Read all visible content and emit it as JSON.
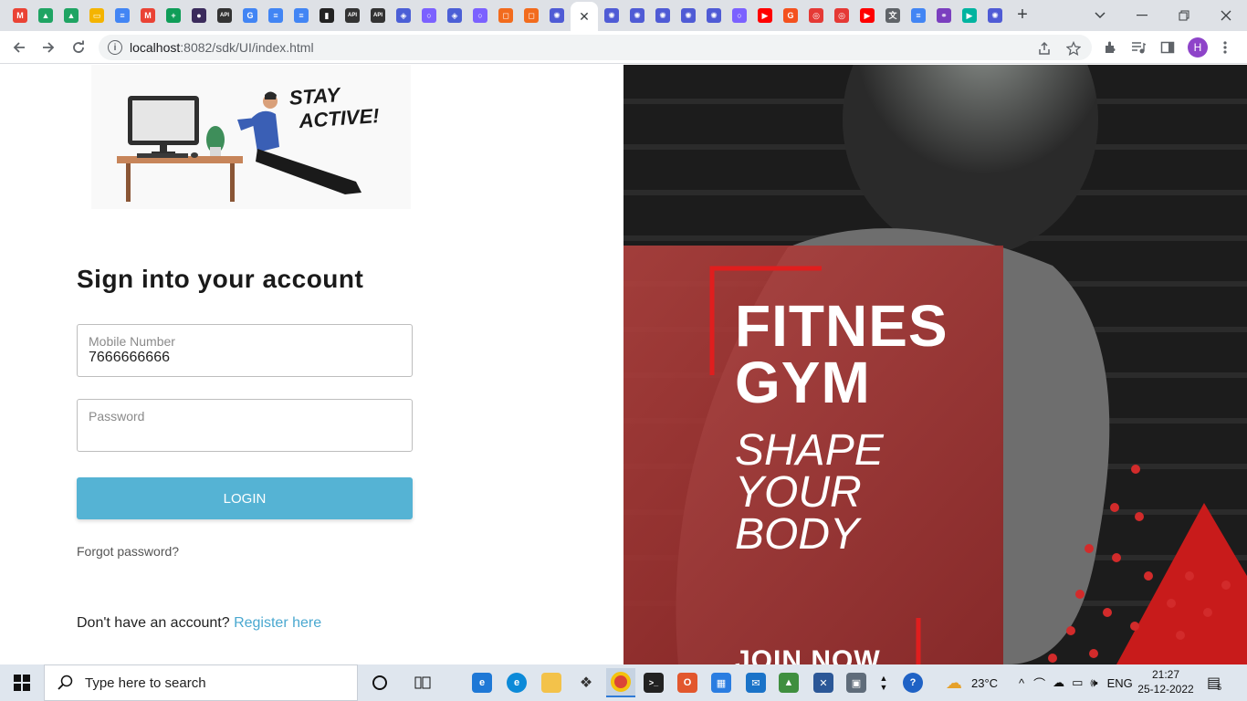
{
  "browser": {
    "tabs": [
      {
        "icon": "gmail-icon",
        "color": "#ea4335",
        "glyph": "M"
      },
      {
        "icon": "google-drive-icon",
        "color": "#1fa463",
        "glyph": "▲"
      },
      {
        "icon": "google-drive-icon",
        "color": "#1fa463",
        "glyph": "▲"
      },
      {
        "icon": "google-slides-icon",
        "color": "#f4b400",
        "glyph": "▭"
      },
      {
        "icon": "google-docs-icon",
        "color": "#4285f4",
        "glyph": "≡"
      },
      {
        "icon": "gmail-icon",
        "color": "#ea4335",
        "glyph": "M"
      },
      {
        "icon": "google-sheets-icon",
        "color": "#0f9d58",
        "glyph": "+"
      },
      {
        "icon": "app-icon",
        "color": "#3b2b5c",
        "glyph": "●"
      },
      {
        "icon": "api-icon",
        "color": "#333333",
        "glyph": "API"
      },
      {
        "icon": "google-icon",
        "color": "#4285f4",
        "glyph": "G"
      },
      {
        "icon": "google-docs-icon",
        "color": "#4285f4",
        "glyph": "≡"
      },
      {
        "icon": "google-docs-icon",
        "color": "#4285f4",
        "glyph": "≡"
      },
      {
        "icon": "file-icon",
        "color": "#222222",
        "glyph": "▮"
      },
      {
        "icon": "api-icon",
        "color": "#333333",
        "glyph": "API"
      },
      {
        "icon": "api-icon",
        "color": "#333333",
        "glyph": "API"
      },
      {
        "icon": "layers-icon",
        "color": "#4b5fd6",
        "glyph": "◈"
      },
      {
        "icon": "circle-app-icon",
        "color": "#7b61ff",
        "glyph": "○"
      },
      {
        "icon": "layers-icon",
        "color": "#4b5fd6",
        "glyph": "◈"
      },
      {
        "icon": "circle-app-icon",
        "color": "#7b61ff",
        "glyph": "○"
      },
      {
        "icon": "chat-icon",
        "color": "#f26b1d",
        "glyph": "◻"
      },
      {
        "icon": "chat-icon",
        "color": "#f26b1d",
        "glyph": "◻"
      },
      {
        "icon": "gear-icon",
        "color": "#4f5bd5",
        "glyph": "✺"
      }
    ],
    "active_tab_close": "✕",
    "tabs_after": [
      {
        "icon": "gear-icon",
        "color": "#4f5bd5",
        "glyph": "✺"
      },
      {
        "icon": "gear-icon",
        "color": "#4f5bd5",
        "glyph": "✺"
      },
      {
        "icon": "gear-icon",
        "color": "#4f5bd5",
        "glyph": "✺"
      },
      {
        "icon": "gear-icon",
        "color": "#4f5bd5",
        "glyph": "✺"
      },
      {
        "icon": "gear-icon",
        "color": "#4f5bd5",
        "glyph": "✺"
      },
      {
        "icon": "circle-app-icon",
        "color": "#7b61ff",
        "glyph": "○"
      },
      {
        "icon": "youtube-icon",
        "color": "#ff0000",
        "glyph": "▶"
      },
      {
        "icon": "shield-icon",
        "color": "#f4511e",
        "glyph": "G"
      },
      {
        "icon": "target-icon",
        "color": "#e53935",
        "glyph": "◎"
      },
      {
        "icon": "target-icon",
        "color": "#e53935",
        "glyph": "◎"
      },
      {
        "icon": "youtube-icon",
        "color": "#ff0000",
        "glyph": "▶"
      },
      {
        "icon": "translate-icon",
        "color": "#5f6368",
        "glyph": "文"
      },
      {
        "icon": "google-docs-icon",
        "color": "#4285f4",
        "glyph": "≡"
      },
      {
        "icon": "link-icon",
        "color": "#7b3fbf",
        "glyph": "⚭"
      },
      {
        "icon": "play-icon",
        "color": "#00b4a0",
        "glyph": "▶"
      },
      {
        "icon": "gear-icon",
        "color": "#4f5bd5",
        "glyph": "✺"
      }
    ],
    "new_tab": "+",
    "url_host": "localhost",
    "url_path": ":8082/sdk/UI/index.html",
    "profile_initial": "H"
  },
  "page": {
    "illustration_text": "STAY ACTIVE!",
    "signin_title": "Sign into your account",
    "mobile": {
      "label": "Mobile Number",
      "value": "7666666666"
    },
    "password": {
      "label": "Password",
      "value": ""
    },
    "login_label": "LOGIN",
    "forgot_label": "Forgot password?",
    "register_prompt": "Don't have an account?",
    "register_link": "Register here",
    "poster": {
      "title_line1": "FITNES",
      "title_line2": "GYM",
      "sub_line1": "SHAPE",
      "sub_line2": "YOUR",
      "sub_line3": "BODY",
      "cta": "JOIN NOW"
    }
  },
  "taskbar": {
    "search_placeholder": "Type here to search",
    "weather": "23°C",
    "language": "ENG",
    "time": "21:27",
    "date": "25-12-2022",
    "notification_count": "5"
  }
}
